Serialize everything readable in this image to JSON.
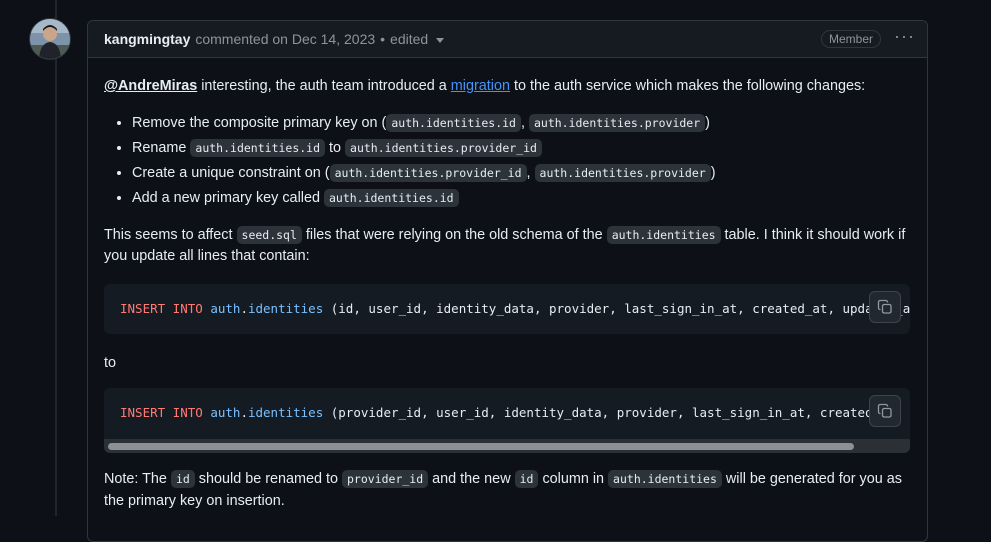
{
  "comment": {
    "author": "kangmingtay",
    "meta": "commented on Dec 14, 2023",
    "separator": "•",
    "edited": "edited",
    "role_badge": "Member",
    "menu": "···"
  },
  "body": {
    "p1_mention": "@AndreMiras",
    "p1_text_a": " interesting, the auth team introduced a ",
    "p1_link": "migration",
    "p1_text_b": " to the auth service which makes the following changes:",
    "bullets": [
      {
        "pre": "Remove the composite primary key on (",
        "c1": "auth.identities.id",
        "mid": ", ",
        "c2": "auth.identities.provider",
        "post": ")"
      },
      {
        "pre": "Rename ",
        "c1": "auth.identities.id",
        "mid": " to ",
        "c2": "auth.identities.provider_id",
        "post": ""
      },
      {
        "pre": "Create a unique constraint on (",
        "c1": "auth.identities.provider_id",
        "mid": ", ",
        "c2": "auth.identities.provider",
        "post": ")"
      },
      {
        "pre": "Add a new primary key called ",
        "c1": "auth.identities.id",
        "mid": "",
        "c2": "",
        "post": ""
      }
    ],
    "p2_a": "This seems to affect ",
    "p2_code1": "seed.sql",
    "p2_b": " files that were relying on the old schema of the ",
    "p2_code2": "auth.identities",
    "p2_c": " table. I think it should work if you update all lines that contain:",
    "code1": {
      "kw": "INSERT INTO",
      "schema": "auth",
      "dot": ".",
      "table": "identities",
      "rest": " (id, user_id, identity_data, provider, last_sign_in_at, created_at, updated_at) VALUES"
    },
    "p3": "to",
    "code2": {
      "kw": "INSERT INTO",
      "schema": "auth",
      "dot": ".",
      "table": "identities",
      "rest": " (provider_id, user_id, identity_data, provider, last_sign_in_at, created_at, updated_at) VALUES"
    },
    "p4_a": "Note: The ",
    "p4_code1": "id",
    "p4_b": " should be renamed to ",
    "p4_code2": "provider_id",
    "p4_c": " and the new ",
    "p4_code3": "id",
    "p4_d": " column in ",
    "p4_code4": "auth.identities",
    "p4_e": " will be generated for you as the primary key on insertion."
  },
  "icons": {
    "copy": "copy-icon",
    "caret": "caret-down-icon",
    "kebab": "kebab-horizontal-icon"
  }
}
